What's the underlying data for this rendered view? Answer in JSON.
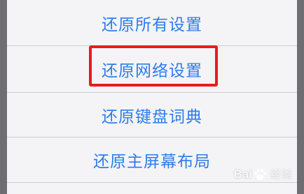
{
  "reset_menu": {
    "options": [
      {
        "label": "还原所有设置"
      },
      {
        "label": "还原网络设置"
      },
      {
        "label": "还原键盘词典"
      },
      {
        "label": "还原主屏幕布局"
      }
    ]
  },
  "watermark": {
    "brand_prefix": "Bai",
    "brand_suffix": "经验"
  },
  "colors": {
    "option_text": "#2f7bea",
    "highlight_border": "#e81c1c",
    "sheet_background": "#f4f4f6",
    "backdrop": "#6e6e72"
  },
  "icons": {
    "watermark_logo": "baidu-paw-icon"
  }
}
